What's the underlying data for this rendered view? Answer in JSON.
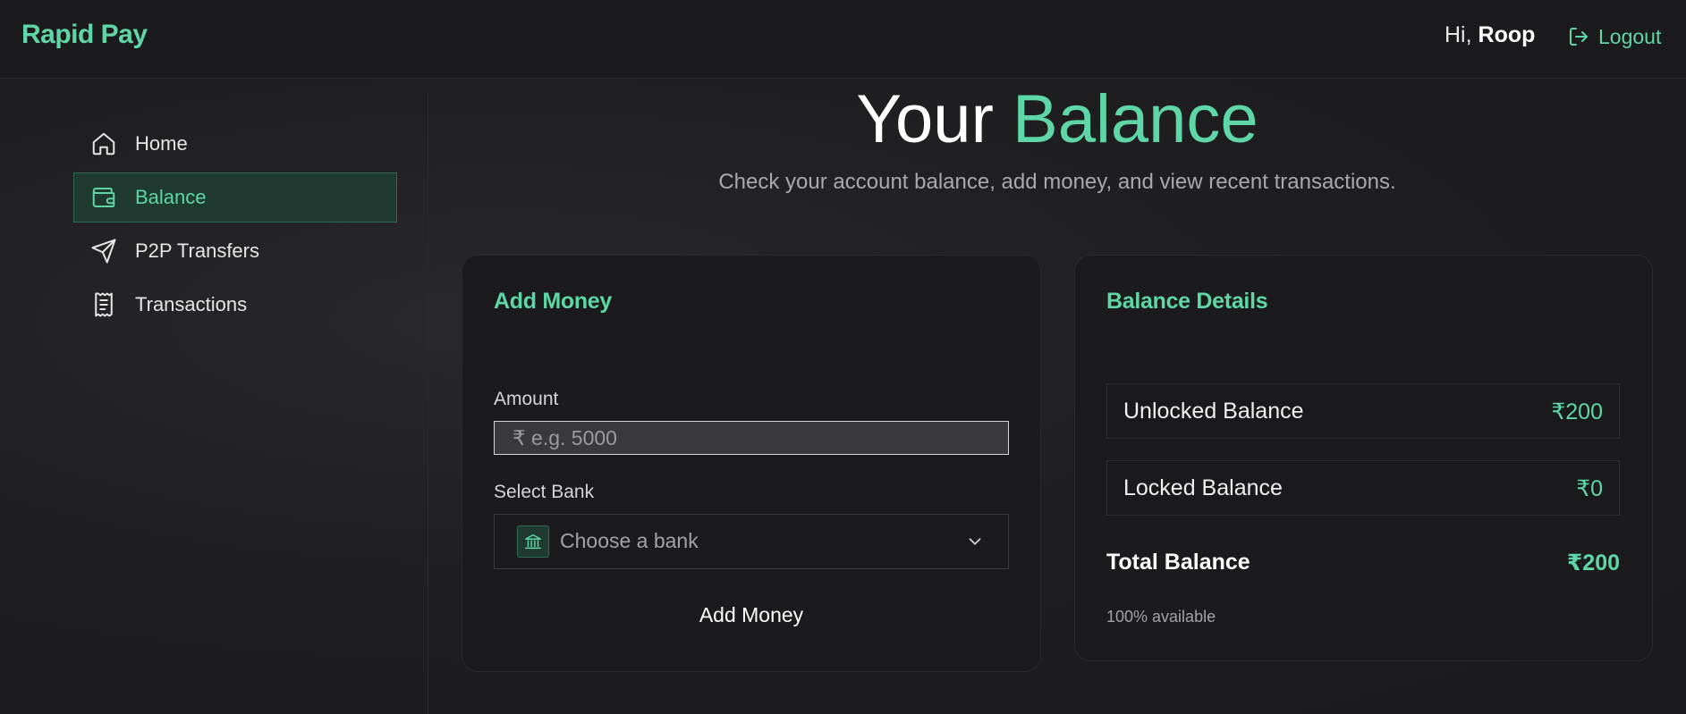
{
  "header": {
    "brand": "Rapid Pay",
    "greeting_prefix": "Hi,",
    "user_name": "Roop",
    "logout_label": "Logout"
  },
  "sidebar": {
    "items": [
      {
        "label": "Home",
        "icon": "home-icon",
        "active": false
      },
      {
        "label": "Balance",
        "icon": "wallet-icon",
        "active": true
      },
      {
        "label": "P2P Transfers",
        "icon": "send-icon",
        "active": false
      },
      {
        "label": "Transactions",
        "icon": "receipt-icon",
        "active": false
      }
    ]
  },
  "page": {
    "title_part1": "Your",
    "title_part2": "Balance",
    "subtitle": "Check your account balance, add money, and view recent transactions."
  },
  "add_money": {
    "title": "Add Money",
    "amount_label": "Amount",
    "amount_placeholder": "₹ e.g. 5000",
    "bank_label": "Select Bank",
    "bank_placeholder": "Choose a bank",
    "button_label": "Add Money"
  },
  "balance_details": {
    "title": "Balance Details",
    "unlocked_label": "Unlocked Balance",
    "unlocked_value": "₹200",
    "locked_label": "Locked Balance",
    "locked_value": "₹0",
    "total_label": "Total Balance",
    "total_value": "₹200",
    "available_text": "100% available"
  },
  "colors": {
    "accent": "#5fd6a6",
    "background": "#1f1f21",
    "card": "#1b1b1d"
  }
}
